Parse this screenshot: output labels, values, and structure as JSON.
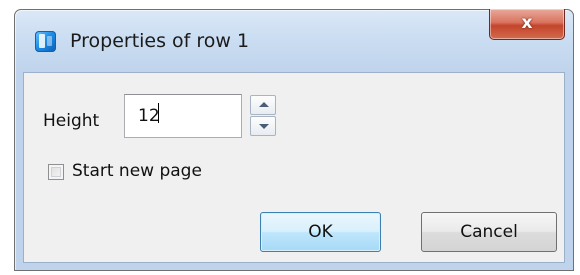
{
  "window": {
    "title": "Properties of row 1",
    "close_symbol": "x",
    "icon": "app-icon"
  },
  "form": {
    "height_label": "Height",
    "height_value": "12",
    "start_new_page_label": "Start new page",
    "start_new_page_checked": false
  },
  "buttons": {
    "ok_label": "OK",
    "cancel_label": "Cancel"
  },
  "colors": {
    "close_button": "#c4452b",
    "default_button_border": "#3c7fb1"
  }
}
